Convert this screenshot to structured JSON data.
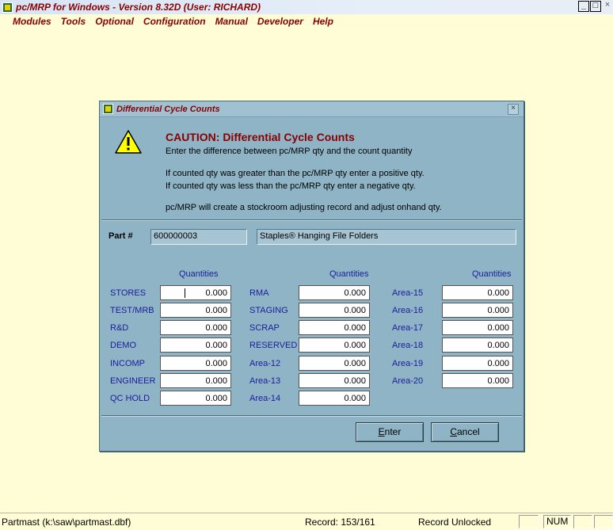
{
  "window": {
    "title": "pc/MRP for Windows - Version 8.32D  (User: RICHARD)",
    "buttons": [
      "_",
      "□",
      "×"
    ]
  },
  "menu": [
    "Modules",
    "Tools",
    "Optional",
    "Configuration",
    "Manual",
    "Developer",
    "Help"
  ],
  "dialog": {
    "title": "Differential Cycle Counts",
    "close_glyph": "×",
    "heading": "CAUTION:  Differential Cycle Counts",
    "lines": [
      "Enter the difference between pc/MRP qty and the count quantity",
      "If counted qty was greater than the pc/MRP qty enter a positive qty.",
      "If counted qty was less than the pc/MRP qty enter a negative qty.",
      "pc/MRP will create a stockroom adjusting record and adjust onhand qty."
    ],
    "part_label": "Part #",
    "part_number": "600000003",
    "part_description": "Staples® Hanging File Folders",
    "quantities_header": "Quantities",
    "col1": [
      {
        "label": "STORES",
        "value": "0.000"
      },
      {
        "label": "TEST/MRB",
        "value": "0.000"
      },
      {
        "label": "R&D",
        "value": "0.000"
      },
      {
        "label": "DEMO",
        "value": "0.000"
      },
      {
        "label": "INCOMP",
        "value": "0.000"
      },
      {
        "label": "ENGINEER",
        "value": "0.000"
      },
      {
        "label": "QC HOLD",
        "value": "0.000"
      }
    ],
    "col2": [
      {
        "label": "RMA",
        "value": "0.000"
      },
      {
        "label": "STAGING",
        "value": "0.000"
      },
      {
        "label": "SCRAP",
        "value": "0.000"
      },
      {
        "label": "RESERVED",
        "value": "0.000"
      },
      {
        "label": "Area-12",
        "value": "0.000"
      },
      {
        "label": "Area-13",
        "value": "0.000"
      },
      {
        "label": "Area-14",
        "value": "0.000"
      }
    ],
    "col3": [
      {
        "label": "Area-15",
        "value": "0.000"
      },
      {
        "label": "Area-16",
        "value": "0.000"
      },
      {
        "label": "Area-17",
        "value": "0.000"
      },
      {
        "label": "Area-18",
        "value": "0.000"
      },
      {
        "label": "Area-19",
        "value": "0.000"
      },
      {
        "label": "Area-20",
        "value": "0.000"
      }
    ],
    "enter_first": "E",
    "enter_rest": "nter",
    "cancel_first": "C",
    "cancel_rest": "ancel"
  },
  "status": {
    "file": "Partmast (k:\\saw\\partmast.dbf)",
    "record": "Record: 153/161",
    "lock": "Record Unlocked",
    "num": "NUM"
  },
  "colors": {
    "background": "#fffdd6",
    "dialog_bg": "#8eb4c6",
    "title_red": "#8a0000",
    "label_blue": "#1c1c9c"
  }
}
